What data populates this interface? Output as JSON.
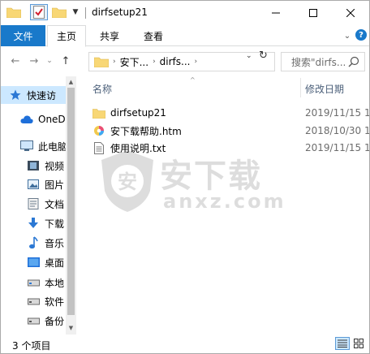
{
  "window": {
    "title": "dirfsetup21"
  },
  "ribbon": {
    "tabs": [
      {
        "label": "文件"
      },
      {
        "label": "主页"
      },
      {
        "label": "共享"
      },
      {
        "label": "查看"
      }
    ]
  },
  "address": {
    "segments": [
      "安下...",
      "dirfs..."
    ],
    "search_placeholder": "搜索\"dirfs..."
  },
  "navpane": {
    "items": [
      {
        "label": "快速访",
        "icon": "star-icon"
      },
      {
        "label": "OneD",
        "icon": "cloud-icon"
      },
      {
        "label": "此电脑",
        "icon": "computer-icon"
      },
      {
        "label": "视频",
        "icon": "video-icon"
      },
      {
        "label": "图片",
        "icon": "pictures-icon"
      },
      {
        "label": "文档",
        "icon": "documents-icon"
      },
      {
        "label": "下载",
        "icon": "download-icon"
      },
      {
        "label": "音乐",
        "icon": "music-icon"
      },
      {
        "label": "桌面",
        "icon": "desktop-icon"
      },
      {
        "label": "本地",
        "icon": "drive-icon"
      },
      {
        "label": "软件",
        "icon": "drive-icon"
      },
      {
        "label": "备份",
        "icon": "drive-icon"
      }
    ]
  },
  "filelist": {
    "columns": {
      "name": "名称",
      "date": "修改日期"
    },
    "rows": [
      {
        "name": "dirfsetup21",
        "date": "2019/11/15 1",
        "icon": "folder-icon"
      },
      {
        "name": "安下载帮助.htm",
        "date": "2018/10/30 1",
        "icon": "html-file-icon"
      },
      {
        "name": "使用说明.txt",
        "date": "2019/11/15 1",
        "icon": "text-file-icon"
      }
    ]
  },
  "watermark": {
    "title": "安下载",
    "subtitle": "anxz.com"
  },
  "status": {
    "item_count": "3 个项目"
  },
  "colors": {
    "accent": "#1979ca",
    "selected": "#cce8ff",
    "folder": "#f8d775"
  }
}
